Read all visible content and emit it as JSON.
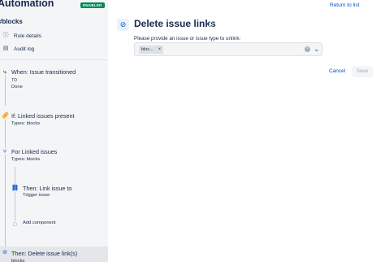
{
  "header": {
    "app_title": "Automation",
    "status_badge": "ENABLED",
    "rule_name": "#blocks",
    "return_link": "Return to list"
  },
  "nav": {
    "rule_details": "Rule details",
    "audit_log": "Audit log"
  },
  "steps": {
    "trigger": {
      "title": "When: Issue transitioned",
      "sub1": "TO",
      "sub2": "Done"
    },
    "condition": {
      "title": "If: Linked issues present",
      "sub": "Types: blocks"
    },
    "branch": {
      "title": "For Linked issues",
      "sub": "Types: blocks"
    },
    "action1": {
      "title": "Then: Link issue to",
      "sub": "Trigger issue"
    },
    "add": {
      "label": "Add component"
    },
    "action2": {
      "title": "Then: Delete issue link(s)",
      "sub": "blocks"
    }
  },
  "panel": {
    "title": "Delete issue links",
    "field_label": "Please provide an issue or issue type to unlink:",
    "chip": "bloc...",
    "cancel_label": "Cancel",
    "save_label": "Save"
  },
  "colors": {
    "accent": "#0052cc",
    "badge": "#00875a",
    "condition_icon": "#ffab00",
    "branch_icon": "#6554c0",
    "trigger_icon": "#00875a"
  }
}
